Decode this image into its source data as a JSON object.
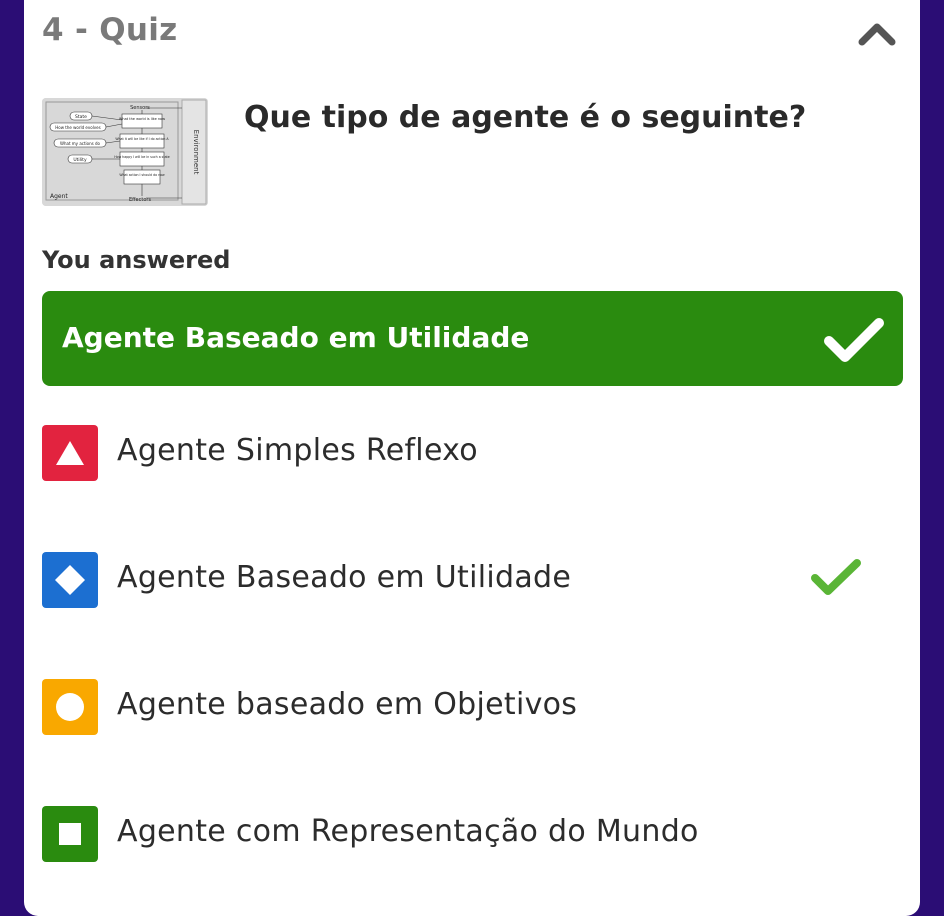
{
  "quiz": {
    "title": "4 - Quiz",
    "collapse_icon": "chevron-up-icon"
  },
  "question": {
    "text": "Que tipo de agente é o seguinte?",
    "diagram": {
      "labels": [
        "Sensors",
        "State",
        "How the world evolves",
        "What my actions do",
        "Utility",
        "What the world is like now",
        "What it will be like if I do action A",
        "How happy I will be in such a state",
        "What action I should do now",
        "Agent",
        "Effectors",
        "Environment"
      ]
    }
  },
  "result": {
    "label": "You answered",
    "answer": "Agente Baseado em Utilidade",
    "answer_icon": "check-icon"
  },
  "options": [
    {
      "label": "Agente Simples Reflexo",
      "icon": "triangle-icon",
      "color": "#e2233f",
      "correct": false
    },
    {
      "label": "Agente Baseado em Utilidade",
      "icon": "diamond-icon",
      "color": "#1c6fd1",
      "correct": true
    },
    {
      "label": "Agente baseado em Objetivos",
      "icon": "circle-icon",
      "color": "#f9a800",
      "correct": false
    },
    {
      "label": "Agente com Representação do Mundo",
      "icon": "square-icon",
      "color": "#2a8b0f",
      "correct": false
    }
  ],
  "colors": {
    "background": "#2b0d75",
    "correct_green": "#2a8b0f",
    "check_green": "#5ab536"
  }
}
